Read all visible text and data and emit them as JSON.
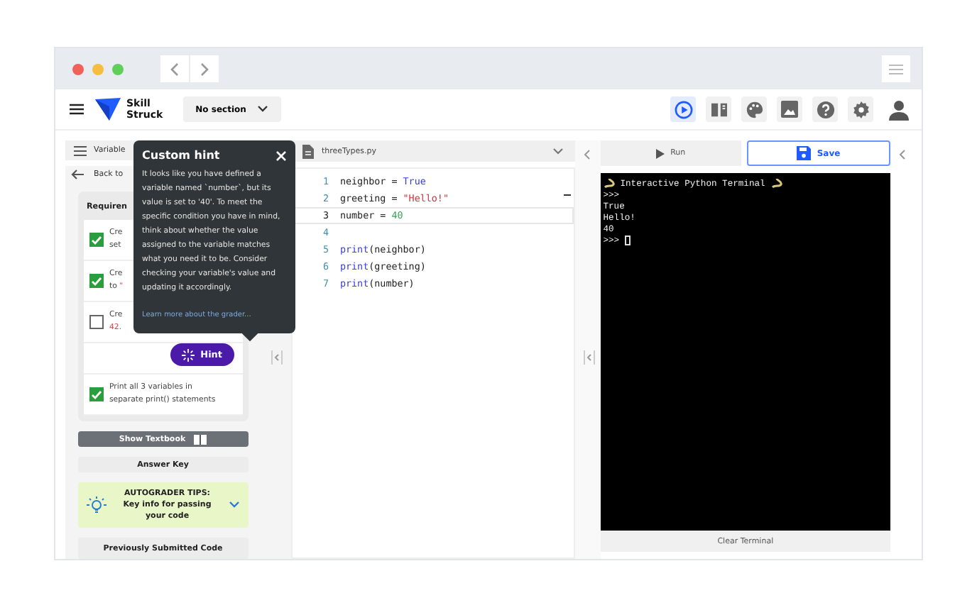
{
  "window": {
    "section_dropdown": "No section",
    "logo": {
      "line1": "Skill",
      "line2": "Struck"
    }
  },
  "toolbar": [
    {
      "kind": "run",
      "selected": true
    },
    {
      "kind": "book",
      "selected": false
    },
    {
      "kind": "palette",
      "selected": false
    },
    {
      "kind": "image",
      "selected": false
    },
    {
      "kind": "help",
      "selected": false
    },
    {
      "kind": "settings",
      "selected": false
    }
  ],
  "left_panel": {
    "tab_label": "Variable",
    "back_label": "Back to",
    "requirements_title": "Requiren",
    "requirements": [
      {
        "checked": true,
        "lines": [
          [
            {
              "text": "Cre"
            }
          ],
          [
            {
              "text": "set"
            }
          ]
        ]
      },
      {
        "checked": true,
        "lines": [
          [
            {
              "text": "Cre"
            }
          ],
          [
            {
              "text": "to "
            },
            {
              "text": "\"",
              "code": true
            }
          ]
        ]
      },
      {
        "checked": false,
        "lines": [
          [
            {
              "text": "Cre"
            }
          ],
          [
            {
              "text": "42.",
              "code": true
            }
          ]
        ]
      },
      {
        "checked": true,
        "lines": [
          [
            {
              "text": "Print all 3 variables in"
            }
          ],
          [
            {
              "text": "separate print() statements"
            }
          ]
        ]
      }
    ],
    "hint_button": "Hint",
    "show_textbook": "Show Textbook",
    "answer_key": "Answer Key",
    "tips": "AUTOGRADER TIPS: Key info for passing your code",
    "previous_code": "Previously Submitted Code"
  },
  "hint_popup": {
    "title": "Custom hint",
    "body": "It looks like you have defined a variable named `number`, but its value is set to '40'. To meet the specific condition you have in mind, think about whether the value assigned to the variable matches what you need it to be. Consider checking your variable's value and updating it accordingly.",
    "link": "Learn more about the grader..."
  },
  "editor": {
    "filename": "threeTypes.py",
    "lines": [
      {
        "number": "1",
        "current": false,
        "tokens": [
          {
            "kind": "plain",
            "text": "neighbor = "
          },
          {
            "kind": "keyword",
            "text": "True"
          }
        ]
      },
      {
        "number": "2",
        "current": false,
        "tokens": [
          {
            "kind": "plain",
            "text": "greeting = "
          },
          {
            "kind": "string",
            "text": "\"Hello!\""
          }
        ]
      },
      {
        "number": "3",
        "current": true,
        "tokens": [
          {
            "kind": "plain",
            "text": "number = "
          },
          {
            "kind": "number",
            "text": "40"
          }
        ]
      },
      {
        "number": "4",
        "current": false
      },
      {
        "number": "5",
        "current": false,
        "tokens": [
          {
            "kind": "keyword",
            "text": "print"
          },
          {
            "kind": "plain",
            "text": "(neighbor)"
          }
        ]
      },
      {
        "number": "6",
        "current": false,
        "tokens": [
          {
            "kind": "keyword",
            "text": "print"
          },
          {
            "kind": "plain",
            "text": "(greeting)"
          }
        ]
      },
      {
        "number": "7",
        "current": false,
        "tokens": [
          {
            "kind": "keyword",
            "text": "print"
          },
          {
            "kind": "plain",
            "text": "(number)"
          }
        ]
      }
    ]
  },
  "terminal": {
    "run_button": "Run",
    "save_button": "Save",
    "title": "Interactive Python Terminal",
    "lines": [
      ">>>",
      "True",
      "Hello!",
      "40",
      ">>>"
    ],
    "clear_button": "Clear Terminal"
  }
}
